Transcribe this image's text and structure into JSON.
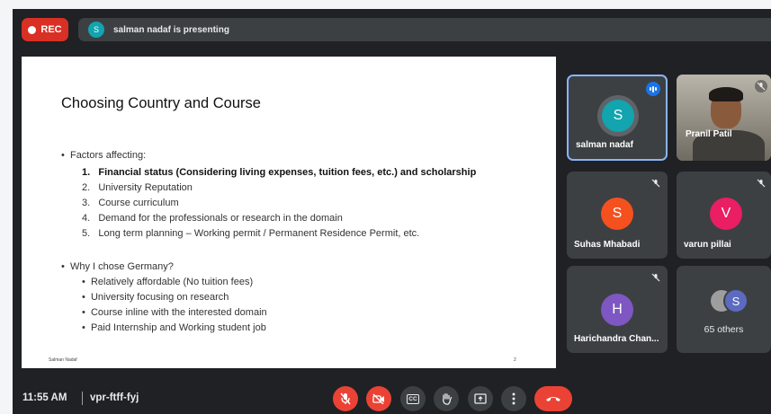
{
  "recording": {
    "label": "REC"
  },
  "presenter_bar": {
    "avatar_initial": "S",
    "text": "salman nadaf is presenting"
  },
  "slide": {
    "title": "Choosing Country and Course",
    "bullet1": "Factors affecting:",
    "factors": [
      {
        "num": "1.",
        "text": "Financial status (Considering living expenses, tuition fees, etc.) and scholarship"
      },
      {
        "num": "2.",
        "text": "University Reputation"
      },
      {
        "num": "3.",
        "text": "Course curriculum"
      },
      {
        "num": "4.",
        "text": "Demand for the professionals or research in the domain"
      },
      {
        "num": "5.",
        "text": "Long term planning – Working permit / Permanent Residence Permit, etc."
      }
    ],
    "bullet2": "Why I chose Germany?",
    "reasons": [
      "Relatively affordable (No tuition fees)",
      "University focusing on research",
      "Course inline with the interested domain",
      "Paid Internship and Working student job"
    ],
    "footer_name": "Salman Nadaf",
    "page_number": "2"
  },
  "participants": {
    "salman": {
      "initial": "S",
      "name": "salman nadaf",
      "color": "#12a4af"
    },
    "pranil": {
      "name": "Pranil Patil"
    },
    "suhas": {
      "initial": "S",
      "name": "Suhas Mhabadi",
      "color": "#f4511e"
    },
    "varun": {
      "initial": "V",
      "name": "varun pillai",
      "color": "#e91e63"
    },
    "harichandra": {
      "initial": "H",
      "name": "Harichandra Chan...",
      "color": "#7e57c2"
    },
    "others": {
      "initial": "S",
      "label": "65 others"
    }
  },
  "bottom_bar": {
    "time": "11:55 AM",
    "separator": "|",
    "meeting_code": "vpr-ftff-fyj"
  },
  "controls": {
    "mic_icon": "mic-off-icon",
    "camera_icon": "camera-off-icon",
    "captions_icon": "cc-icon",
    "captions_label": "CC",
    "hand_icon": "raise-hand-icon",
    "present_icon": "present-icon",
    "more_icon": "more-vert-icon",
    "end_icon": "end-call-icon",
    "danger_color": "#ea4335"
  }
}
